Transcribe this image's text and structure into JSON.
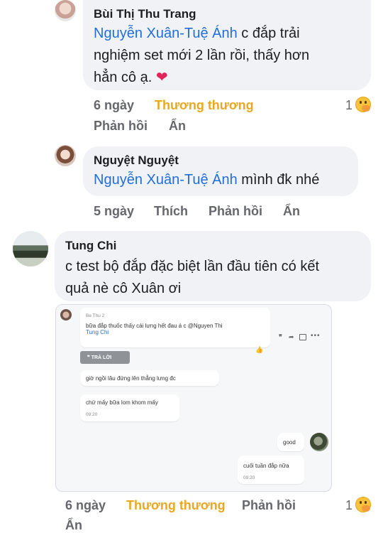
{
  "comments": [
    {
      "author": "Bùi Thị Thu Trang",
      "mention": "Nguyễn Xuân-Tuệ Ánh",
      "line1_rest": " c đắp trải",
      "line2": "nghiệm set mới 2 lần rồi, thấy hơn",
      "line3": "hẳn cô ạ. ",
      "heart": "❤",
      "time": "6 ngày",
      "reaction": "Thương thương",
      "reply": "Phản hồi",
      "hide": "Ẩn",
      "reaction_count": "1"
    },
    {
      "author": "Nguyệt Nguyệt",
      "mention": "Nguyễn Xuân-Tuệ Ánh",
      "text_rest": " mình đk nhé",
      "time": "5 ngày",
      "like": "Thích",
      "reply": "Phản hồi",
      "hide": "Ẩn"
    },
    {
      "author": "Tung Chi",
      "line1": "c test bộ đắp đặc biệt lần đầu tiên có kết",
      "line2": "quả nè cô Xuân ơi",
      "time": "6 ngày",
      "reaction": "Thương thương",
      "reply": "Phản hồi",
      "hide": "Ẩn",
      "reaction_count": "1"
    }
  ],
  "screenshot": {
    "sender": "Be Thu 2",
    "msg1_line1": "bữa đắp thuốc thấy cái lưng hết đau á c @Nguyen Thi",
    "msg1_line2": "Tung Chi",
    "reply_button": "TRẢ LỜI",
    "msg2": "giờ ngồi lâu đứng lên thẳng lưng đc",
    "msg3": "chứ mấy bữa lom khom mấy",
    "msg3_time": "09:20",
    "msg4": "good",
    "msg5": "cuối tuần đắp nữa",
    "msg5_time": "09:20"
  }
}
